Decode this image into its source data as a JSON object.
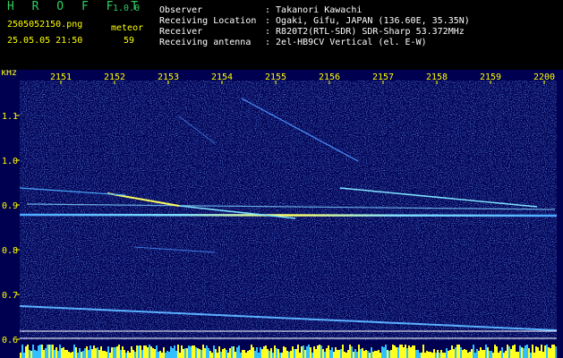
{
  "app": {
    "name": "H R O F F T",
    "version": "1.0.0"
  },
  "file": {
    "name": "2505052150.png",
    "datetime": "25.05.05 21:50"
  },
  "meteor": {
    "label": "meteor",
    "count": "59"
  },
  "info": [
    {
      "label": "Observer",
      "value": ": Takanori Kawachi"
    },
    {
      "label": "Receiving Location",
      "value": ": Ogaki, Gifu, JAPAN (136.60E, 35.35N)"
    },
    {
      "label": "Receiver",
      "value": ": R820T2(RTL-SDR) SDR-Sharp 53.372MHz"
    },
    {
      "label": "Receiving antenna",
      "value": ": 2el-HB9CV Vertical (el. E-W)"
    }
  ],
  "spectrogram": {
    "y_unit": "kHz",
    "y_ticks": [
      "1.1",
      "1.0",
      "0.9",
      "0.8",
      "0.7",
      "0.6"
    ],
    "x_ticks": [
      "2151",
      "2152",
      "2153",
      "2154",
      "2155",
      "2156",
      "2157",
      "2158",
      "2159",
      "2200"
    ],
    "colors": {
      "background": "#000050",
      "noise": "#1a3cc8",
      "trace": "#4aa8ff",
      "hot": "#ffff40",
      "axis": "#ffff00"
    }
  }
}
